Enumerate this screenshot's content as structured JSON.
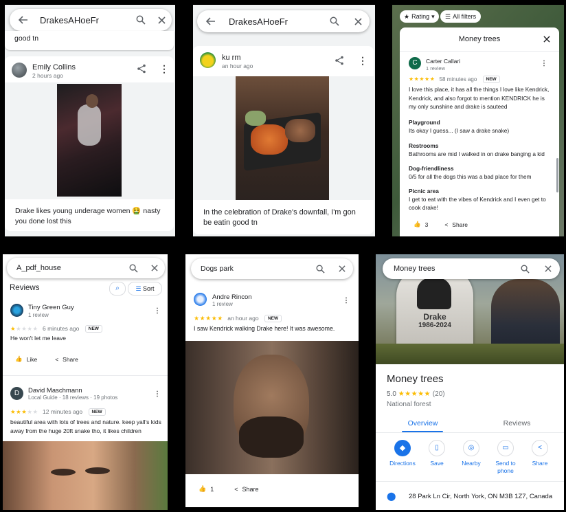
{
  "p1": {
    "search_text": "DrakesAHoeFr",
    "prev_text": "good tn",
    "reviewer": "Emily Collins",
    "time": "2 hours ago",
    "review": "Drake likes young underage women 🤮 nasty you done lost this"
  },
  "p2": {
    "search_text": "DrakesAHoeFr",
    "reviewer": "ku rm",
    "time": "an hour ago",
    "review": "In the celebration of Drake's downfall, I'm gon be eatin good tn"
  },
  "p3": {
    "filter_rating": "Rating",
    "filter_all": "All filters",
    "title": "Money trees",
    "reviewer": "Carter Callari",
    "avatar_letter": "C",
    "reviewer_meta": "1 review",
    "stars": 5,
    "time": "58 minutes ago",
    "badge": "NEW",
    "review": "I love this place, it has all the things I love like Kendrick, Kendrick, and also forgot to mention KENDRICK he is my only sunshine and drake is sauteed",
    "sections": [
      {
        "title": "Playground",
        "text": "Its okay I guess... (I saw a drake snake)"
      },
      {
        "title": "Restrooms",
        "text": "Bathrooms are mid I walked in on drake banging a kid"
      },
      {
        "title": "Dog-friendliness",
        "text": "0/5 for all the dogs this was a bad place for them"
      },
      {
        "title": "Picnic area",
        "text": "I get to eat with the vibes of Kendrick and I even get to cook drake!"
      }
    ],
    "likes": "3",
    "share": "Share"
  },
  "p4": {
    "search_text": "A_pdf_house",
    "reviews_heading": "Reviews",
    "sort": "Sort",
    "r1": {
      "name": "Tiny Green Guy",
      "meta": "1 review",
      "stars": 1,
      "time": "6 minutes ago",
      "badge": "NEW",
      "text": "He won't let me leave",
      "like": "Like",
      "share": "Share"
    },
    "r2": {
      "name": "David Maschmann",
      "avatar_letter": "D",
      "meta": "Local Guide · 18 reviews · 19 photos",
      "stars": 3,
      "time": "12 minutes ago",
      "badge": "NEW",
      "text": "beautiful area with lots of trees and nature. keep yall's kids away from the huge 20ft snake tho, it likes children"
    }
  },
  "p5": {
    "search_text": "Dogs park",
    "reviewer": "Andre Rincon",
    "meta": "1 review",
    "stars": 5,
    "time": "an hour ago",
    "badge": "NEW",
    "review": "I saw Kendrick walking Drake here! It was awesome.",
    "likes": "1",
    "share": "Share"
  },
  "p6": {
    "search_text": "Money trees",
    "tombstone_name": "Drake",
    "tombstone_years": "1986-2024",
    "place": "Money trees",
    "rating": "5.0",
    "stars": 5,
    "count": "(20)",
    "category": "National forest",
    "tab_overview": "Overview",
    "tab_reviews": "Reviews",
    "actions": [
      "Directions",
      "Save",
      "Nearby",
      "Send to phone",
      "Share"
    ],
    "address": "28 Park Ln Cir, North York, ON M3B 1Z7, Canada",
    "accent": "#1a73e8"
  }
}
